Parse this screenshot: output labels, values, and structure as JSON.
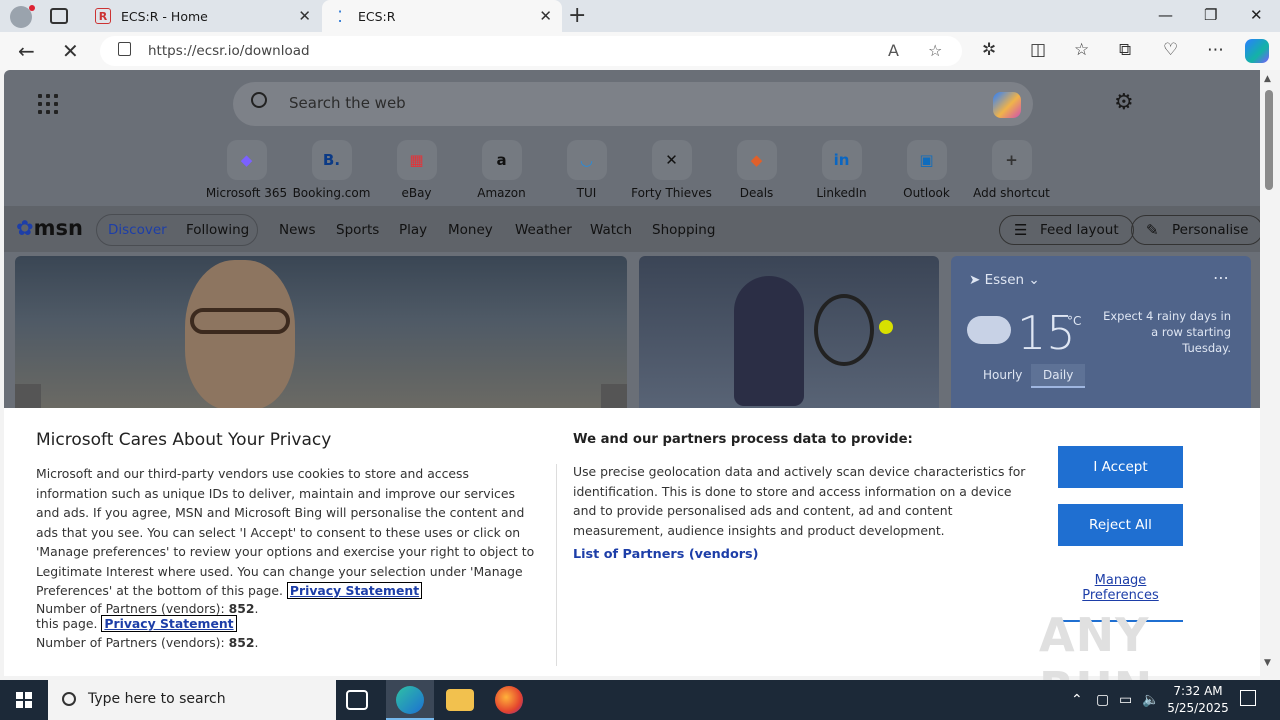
{
  "browser": {
    "tabs": [
      {
        "title": "ECS:R - Home"
      },
      {
        "title": "ECS:R"
      }
    ],
    "url": "https://ecsr.io/download"
  },
  "ntp": {
    "search_placeholder": "Search the web",
    "shortcuts": [
      {
        "label": "Microsoft 365",
        "glyph": "◆",
        "color": "#7b61ff"
      },
      {
        "label": "Booking.com",
        "glyph": "B.",
        "color": "#0b3a86"
      },
      {
        "label": "eBay",
        "glyph": "▦",
        "color": "#e53238"
      },
      {
        "label": "Amazon",
        "glyph": "a",
        "color": "#111111"
      },
      {
        "label": "TUI",
        "glyph": "◡",
        "color": "#2a8bd8"
      },
      {
        "label": "Forty Thieves",
        "glyph": "✕",
        "color": "#111111"
      },
      {
        "label": "Deals",
        "glyph": "◆",
        "color": "#e0602a"
      },
      {
        "label": "LinkedIn",
        "glyph": "in",
        "color": "#0a66c2"
      },
      {
        "label": "Outlook",
        "glyph": "▣",
        "color": "#0f6cbd"
      },
      {
        "label": "Add shortcut",
        "glyph": "+",
        "color": "#333333"
      }
    ]
  },
  "msn": {
    "logo": "msn",
    "nav": [
      "Discover",
      "Following",
      "News",
      "Sports",
      "Play",
      "Money",
      "Weather",
      "Watch",
      "Shopping"
    ],
    "feed_layout": "Feed layout",
    "personalise": "Personalise"
  },
  "weather": {
    "location": "Essen",
    "temperature": "15",
    "unit": "°C",
    "message": "Expect 4 rainy days in a row starting Tuesday.",
    "tab_hourly": "Hourly",
    "tab_daily": "Daily"
  },
  "consent": {
    "title": "Microsoft Cares About Your Privacy",
    "body": "Microsoft and our third-party vendors use cookies to store and access information such as unique IDs to deliver, maintain and improve our services and ads. If you agree, MSN and Microsoft Bing will personalise the content and ads that you see. You can select 'I Accept' to consent to these uses or click on 'Manage preferences' to review your options and exercise your right to object to Legitimate Interest where used.  You can change your selection under 'Manage Preferences' at the bottom of this page.",
    "privacy_link": "Privacy Statement",
    "partners_label": "Number of Partners (vendors):",
    "partners_count": "852",
    "ghost_prefix": "this page.",
    "purposes_heading": "We and our partners process data to provide:",
    "purposes_body": "Use precise geolocation data and actively scan device characteristics for identification. This is done to store and access information on a device and to provide personalised ads and content, ad and content measurement, audience insights and product development.",
    "vendors_link": "List of Partners (vendors)",
    "accept": "I Accept",
    "reject": "Reject All",
    "manage": "Manage Preferences"
  },
  "watermark": "ANY RUN",
  "taskbar": {
    "search_placeholder": "Type here to search",
    "time": "7:32 AM",
    "date": "5/25/2025"
  }
}
